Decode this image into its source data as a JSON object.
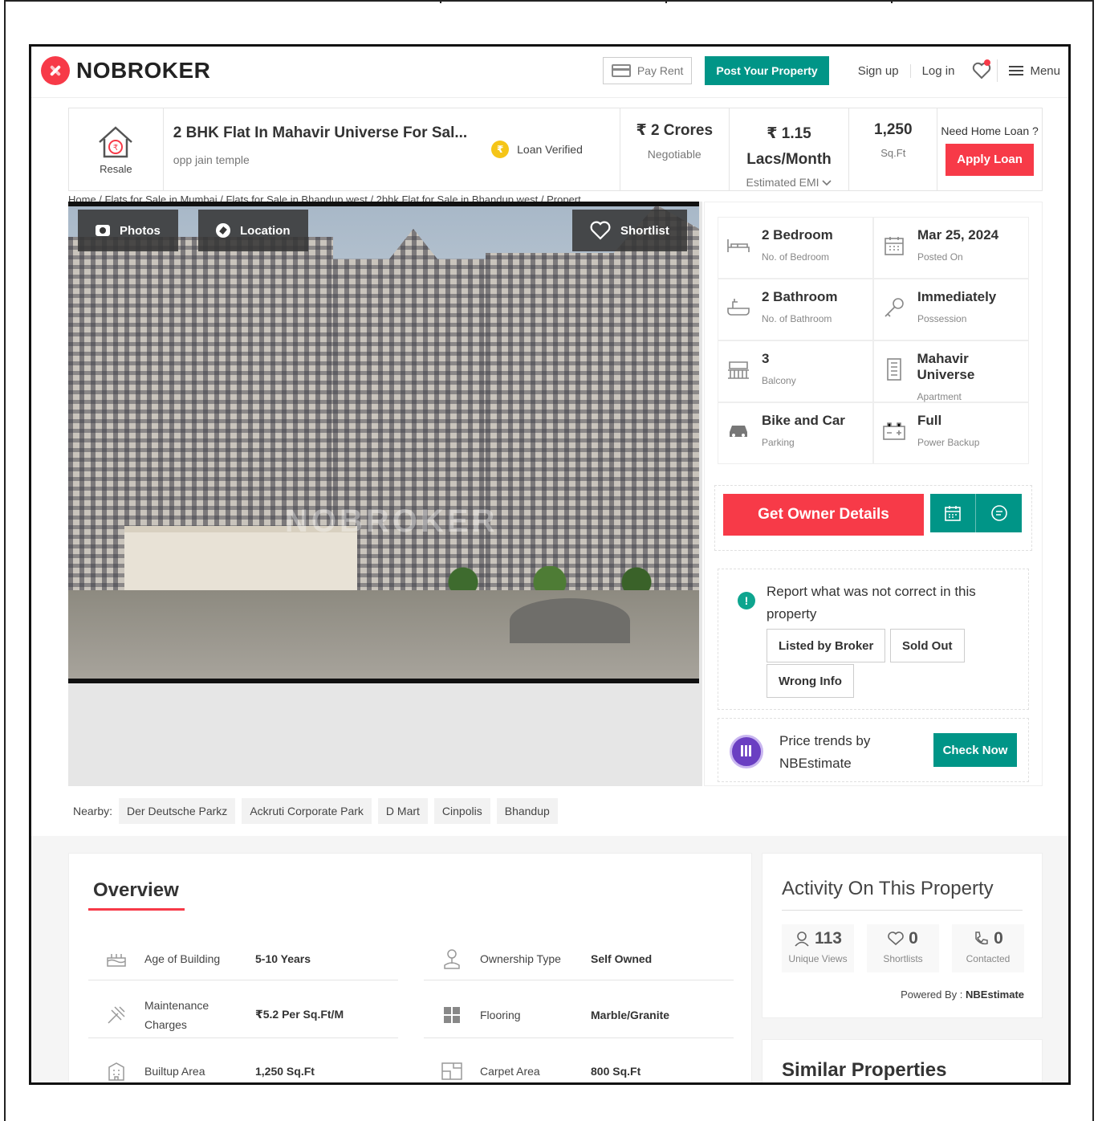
{
  "header": {
    "logo_text": "NOBROKER",
    "pay_rent": "Pay Rent",
    "post_property": "Post Your Property",
    "sign_up": "Sign up",
    "log_in": "Log in",
    "menu": "Menu"
  },
  "property": {
    "type_badge": "Resale",
    "title": "2 BHK Flat In Mahavir Universe For Sal...",
    "subtitle": "opp jain temple",
    "loan_verified": "Loan Verified",
    "price": "₹ 2 Crores",
    "price_label": "Negotiable",
    "emi": "₹ 1.15 Lacs/Month",
    "emi_label": "Estimated EMI",
    "area": "1,250",
    "area_unit": "Sq.Ft",
    "loan_question": "Need Home Loan ?",
    "apply_loan": "Apply Loan"
  },
  "breadcrumb": "Home / Flats for Sale in Mumbai / Flats for Sale in Bhandup west / 2bhk Flat for Sale in Bhandup west / Propert",
  "gallery": {
    "photos": "Photos",
    "location": "Location",
    "shortlist": "Shortlist",
    "watermark": "NOBROKER"
  },
  "nearby": {
    "label": "Nearby:",
    "items": [
      "Der Deutsche Parkz",
      "Ackruti Corporate Park",
      "D Mart",
      "Cinpolis",
      "Bhandup"
    ]
  },
  "details": [
    {
      "value": "2 Bedroom",
      "label": "No. of Bedroom",
      "icon": "bed-icon"
    },
    {
      "value": "Mar 25, 2024",
      "label": "Posted On",
      "icon": "calendar-icon"
    },
    {
      "value": "2 Bathroom",
      "label": "No. of Bathroom",
      "icon": "bathtub-icon"
    },
    {
      "value": "Immediately",
      "label": "Possession",
      "icon": "key-icon"
    },
    {
      "value": "3",
      "label": "Balcony",
      "icon": "balcony-icon"
    },
    {
      "value": "Mahavir Universe",
      "label": "Apartment",
      "icon": "building-icon"
    },
    {
      "value": "Bike and Car",
      "label": "Parking",
      "icon": "car-icon"
    },
    {
      "value": "Full",
      "label": "Power Backup",
      "icon": "battery-icon"
    }
  ],
  "actions": {
    "get_owner": "Get Owner Details"
  },
  "report": {
    "text": "Report what was not correct in this property",
    "listed_by_broker": "Listed by Broker",
    "sold_out": "Sold Out",
    "wrong_info": "Wrong Info"
  },
  "trends": {
    "text": "Price trends by NBEstimate",
    "check_now": "Check Now"
  },
  "overview": {
    "title": "Overview",
    "rows": [
      {
        "key": "Age of Building",
        "value": "5-10 Years",
        "icon": "cake-icon"
      },
      {
        "key": "Ownership Type",
        "value": "Self Owned",
        "icon": "owner-icon"
      },
      {
        "key": "Maintenance Charges",
        "value": "₹5.2 Per Sq.Ft/M",
        "icon": "tools-icon"
      },
      {
        "key": "Flooring",
        "value": "Marble/Granite",
        "icon": "tiles-icon"
      },
      {
        "key": "Builtup Area",
        "value": "1,250 Sq.Ft",
        "icon": "building-icon"
      },
      {
        "key": "Carpet Area",
        "value": "800 Sq.Ft",
        "icon": "floorplan-icon"
      }
    ]
  },
  "activity": {
    "title": "Activity On This Property",
    "views": "113",
    "views_label": "Unique Views",
    "shortlists": "0",
    "shortlists_label": "Shortlists",
    "contacted": "0",
    "contacted_label": "Contacted",
    "powered_label": "Powered By :",
    "powered_by": "NBEstimate"
  },
  "similar": {
    "title": "Similar Properties"
  },
  "colors": {
    "brand_red": "#f73a48",
    "brand_teal": "#009587"
  }
}
